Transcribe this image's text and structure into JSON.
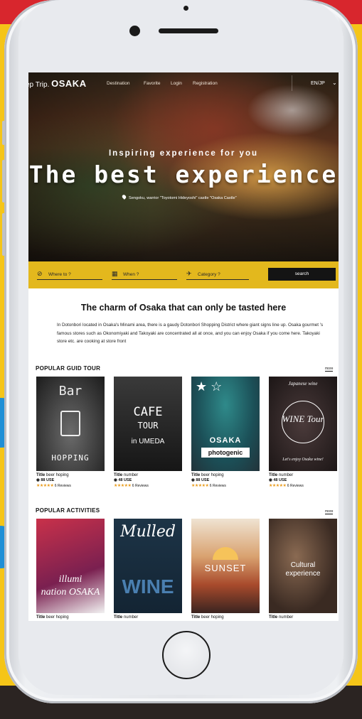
{
  "nav": {
    "logo_prefix": "ep Trip.",
    "logo_main": "OSAKA",
    "links": [
      "Destination",
      "Favorite",
      "Login",
      "Registration"
    ],
    "language": "EN/JP"
  },
  "hero": {
    "tagline": "Inspiring experience for you",
    "headline": "The best experience",
    "location": "Sengoku, warrior \"Toyotomi Hideyoshi\" castle \"Osaka Castle\""
  },
  "search": {
    "where": "Where to ?",
    "when": "When ?",
    "category": "Category ?",
    "button": "search"
  },
  "intro": {
    "title": "The charm of Osaka that can only be tasted here",
    "body": "In Dotonbori located in Osaka's Minami area, there is a gaudy Dotonbori Shopping District where giant signs line up. Osaka gourmet 's famous stores such as Okonomiyaki and Takoyaki are concentrated all at once, and you can enjoy Osaka if you come here. Takoyaki store etc. are cooking at store front"
  },
  "tours": {
    "title": "POPULAR GUID TOUR",
    "more": "more",
    "cards": [
      {
        "image_text": "Bar HOPPING",
        "title_label": "Title",
        "title": "beer hoping",
        "price": "88 USE",
        "stars": "★★★★★",
        "reviews": "6 Reviews"
      },
      {
        "image_text": "CAFE TOUR in UMEDA",
        "title_label": "Title",
        "title": "number",
        "price": "48 USE",
        "stars": "★★★★★",
        "reviews": "6 Reviews"
      },
      {
        "image_text": "OSAKA photogenic",
        "title_label": "Title",
        "title": "beer hoping",
        "price": "88 USE",
        "stars": "★★★★★",
        "reviews": "6 Reviews"
      },
      {
        "image_text": "Japanese wine WINE Tour Let's enjoy Osaka wine!",
        "title_label": "Title",
        "title": "number",
        "price": "48 USE",
        "stars": "★★★★★",
        "reviews": "6 Reviews"
      }
    ]
  },
  "activities": {
    "title": "POPULAR ACTIVITIES",
    "more": "more",
    "cards": [
      {
        "image_text": "illumi nation OSAKA",
        "title_label": "Title",
        "title": "beer hoping"
      },
      {
        "image_text": "Mulled WINE",
        "title_label": "Title",
        "title": "number"
      },
      {
        "image_text": "SUNSET",
        "title_label": "Title",
        "title": "beer hoping"
      },
      {
        "image_text": "Cultural experience",
        "title_label": "Title",
        "title": "number"
      }
    ]
  }
}
